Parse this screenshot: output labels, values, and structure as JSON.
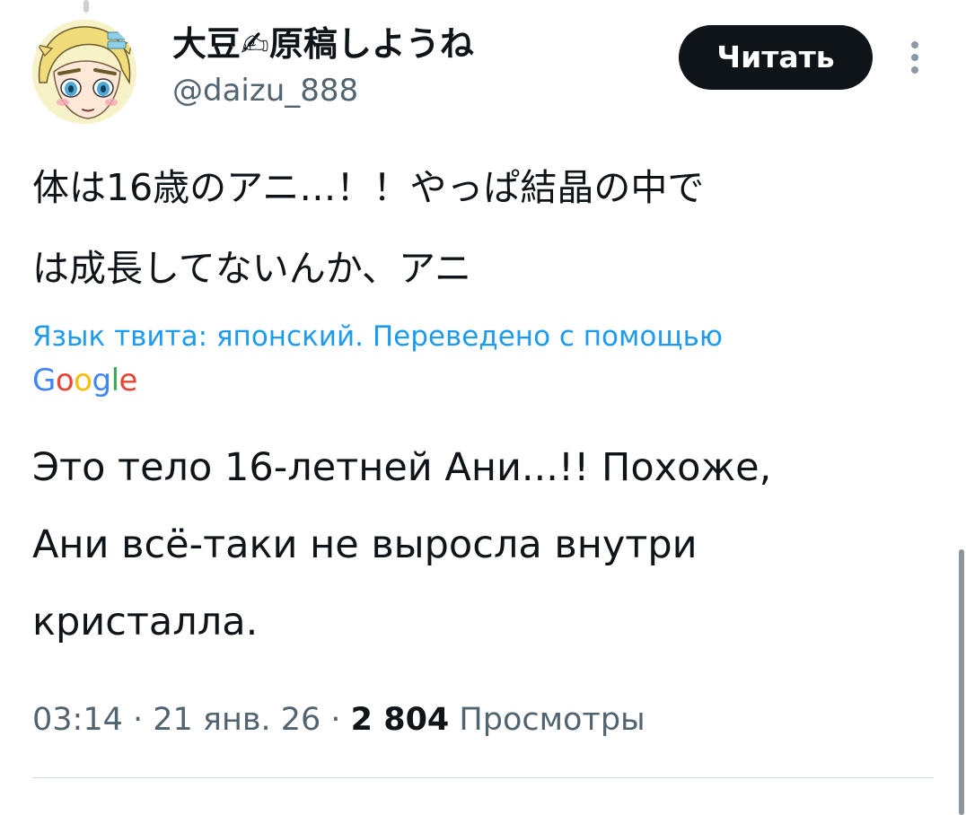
{
  "author": {
    "display_name": "大豆✍原稿しようね",
    "handle": "@daizu_888",
    "avatar_icon": "anime-character-avatar"
  },
  "header": {
    "follow_label": "Читать",
    "more_icon": "more-vertical-icon"
  },
  "tweet": {
    "original_lines": [
      "体は16歳のアニ…！！やっぱ結晶の中で",
      "は成長してないんか、アニ"
    ],
    "translation_note": "Язык твита: японский. Переведено с помощью",
    "translation_provider": "Google",
    "translated_lines": [
      "Это тело 16-летней Ани...!! Похоже,",
      "Ани всё-таки не выросла внутри",
      "кристалла."
    ]
  },
  "meta": {
    "time": "03:14",
    "separator": " · ",
    "date": "21 янв. 26",
    "views_count": "2 804",
    "views_label": "Просмотры"
  },
  "colors": {
    "link": "#1d9bf0",
    "secondary_text": "#536471",
    "primary_text": "#0f1419",
    "button_bg": "#0f1419"
  }
}
